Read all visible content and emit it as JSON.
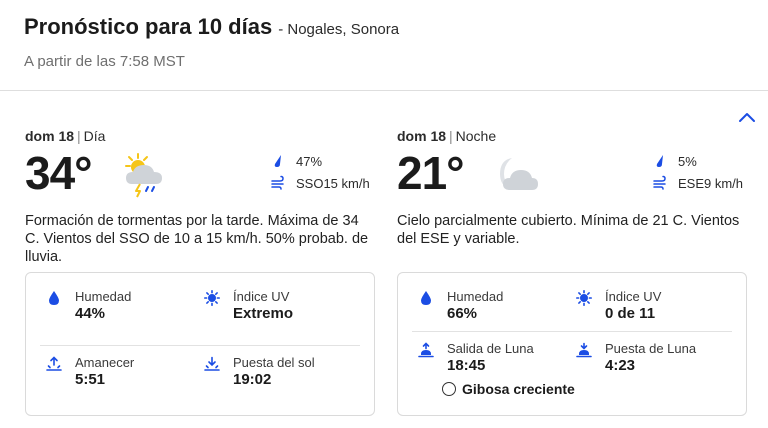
{
  "header": {
    "title": "Pronóstico para 10 días",
    "location": "- Nogales, Sonora",
    "as_of": "A partir de las 7:58 MST"
  },
  "day": {
    "date": "dom 18",
    "part": "Día",
    "temp": "34°",
    "icon": "scattered-thunderstorms-icon",
    "precip": "47%",
    "wind": "SSO15 km/h",
    "narrative": "Formación de tormentas por la tarde. Máxima de 34 C. Vientos del SSO de 10 a 15 km/h. 50% probab. de lluvia.",
    "details": {
      "humidity_label": "Humedad",
      "humidity_value": "44%",
      "uv_label": "Índice UV",
      "uv_value": "Extremo",
      "sunrise_label": "Amanecer",
      "sunrise_value": "5:51",
      "sunset_label": "Puesta del sol",
      "sunset_value": "19:02"
    }
  },
  "night": {
    "date": "dom 18",
    "part": "Noche",
    "temp": "21°",
    "icon": "partly-cloudy-night-icon",
    "precip": "5%",
    "wind": "ESE9 km/h",
    "narrative": "Cielo parcialmente cubierto. Mínima de 21 C. Vientos del ESE y variable.",
    "details": {
      "humidity_label": "Humedad",
      "humidity_value": "66%",
      "uv_label": "Índice UV",
      "uv_value": "0 de 11",
      "moonrise_label": "Salida de Luna",
      "moonrise_value": "18:45",
      "moonset_label": "Puesta de Luna",
      "moonset_value": "4:23",
      "moon_phase": "Gibosa creciente"
    }
  },
  "colors": {
    "accent": "#1b4de4",
    "text": "#252525",
    "muted": "#6f6f6f",
    "border": "#dadada",
    "sun": "#f5c518",
    "cloud": "#cfd3d8"
  }
}
